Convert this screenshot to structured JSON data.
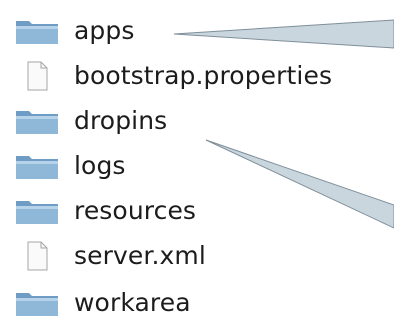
{
  "file_list": {
    "items": [
      {
        "name": "apps",
        "kind": "folder",
        "icon": "folder-icon"
      },
      {
        "name": "bootstrap.properties",
        "kind": "file",
        "icon": "document-icon"
      },
      {
        "name": "dropins",
        "kind": "folder",
        "icon": "folder-icon"
      },
      {
        "name": "logs",
        "kind": "folder",
        "icon": "folder-icon"
      },
      {
        "name": "resources",
        "kind": "folder",
        "icon": "folder-icon"
      },
      {
        "name": "server.xml",
        "kind": "file",
        "icon": "document-icon"
      },
      {
        "name": "workarea",
        "kind": "folder",
        "icon": "folder-icon"
      }
    ]
  },
  "colors": {
    "folder_front": "#8fb8d8",
    "folder_back": "#6f9cc4",
    "connector_fill": "#c9d6de",
    "connector_stroke": "#7f8f9a",
    "text": "#1c1c1c"
  }
}
